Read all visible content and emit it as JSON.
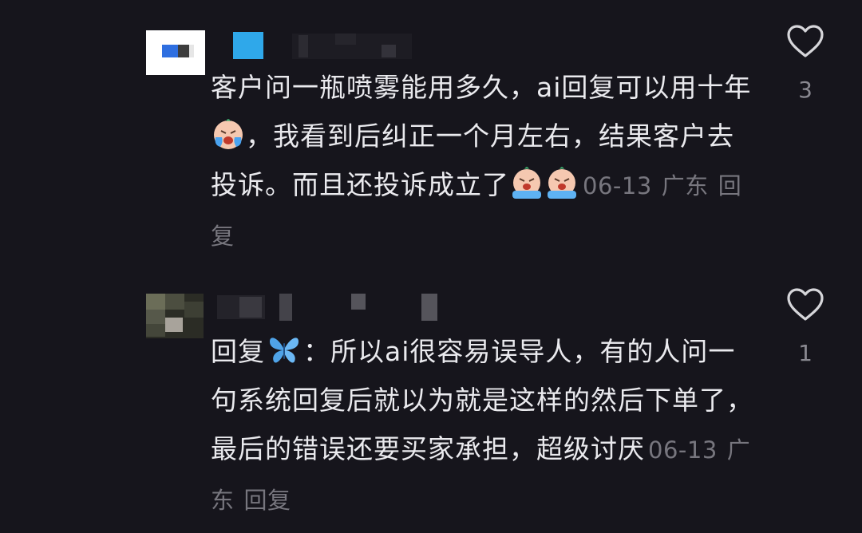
{
  "comments": [
    {
      "avatar_colors": [
        "#ffffff",
        "#2f6fe0",
        "#3d3d3d"
      ],
      "name_icon_color": "#2fa8ea",
      "text_parts": {
        "p1": "客户问一瓶喷雾能用多久，ai回复可以用十年",
        "p2": "，我看到后纠正一个月左右，结果客户去投诉。而且还投诉成立了"
      },
      "date": "06-13",
      "location": "广东",
      "reply_label": "回复",
      "like_count": "3",
      "icons": [
        "heart-outline-icon",
        "crying-emoji-icon"
      ]
    },
    {
      "avatar_colors": [
        "#6b6d58",
        "#3d3f34",
        "#a8a39b"
      ],
      "reply_prefix": "回复",
      "text": "：所以ai很容易误导人，有的人问一句系统回复后就以为就是这样的然后下单了，最后的错误还要买家承担，超级讨厌",
      "date": "06-13",
      "location": "广东",
      "reply_label": "回复",
      "like_count": "1",
      "icons": [
        "heart-outline-icon",
        "butterfly-icon"
      ]
    }
  ],
  "colors": {
    "background": "#16151c",
    "text": "#eaeaee",
    "meta": "#77767e"
  }
}
